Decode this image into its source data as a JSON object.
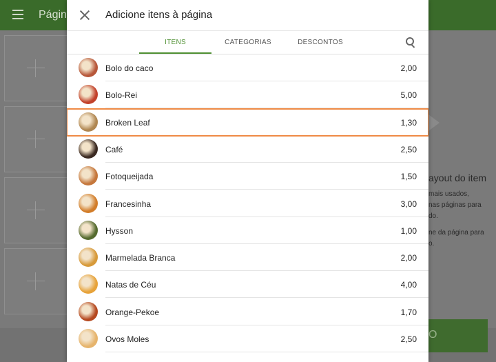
{
  "background": {
    "page_title": "Págin",
    "right_heading": "ayout do item",
    "right_lines": [
      "mais usados,",
      "nas páginas para",
      "do.",
      "ne da página para",
      "o."
    ],
    "green_button_label": "O"
  },
  "dialog": {
    "title": "Adicione itens à página",
    "tabs": [
      {
        "label": "ITENS",
        "active": true
      },
      {
        "label": "CATEGORIAS",
        "active": false
      },
      {
        "label": "DESCONTOS",
        "active": false
      }
    ],
    "items": [
      {
        "name": "Bolo do caco",
        "price": "2,00",
        "thumb_color": "#b7573a"
      },
      {
        "name": "Bolo-Rei",
        "price": "5,00",
        "thumb_color": "#c2412b"
      },
      {
        "name": "Broken Leaf",
        "price": "1,30",
        "thumb_color": "#b08752",
        "highlighted": true
      },
      {
        "name": "Café",
        "price": "2,50",
        "thumb_color": "#3b2a22"
      },
      {
        "name": "Fotoqueijada",
        "price": "1,50",
        "thumb_color": "#c5773c"
      },
      {
        "name": "Francesinha",
        "price": "3,00",
        "thumb_color": "#d27d2a"
      },
      {
        "name": "Hysson",
        "price": "1,00",
        "thumb_color": "#556b2f"
      },
      {
        "name": "Marmelada Branca",
        "price": "2,00",
        "thumb_color": "#d79a3a"
      },
      {
        "name": "Natas de Céu",
        "price": "4,00",
        "thumb_color": "#e7a33a"
      },
      {
        "name": "Orange-Pekoe",
        "price": "1,70",
        "thumb_color": "#b5481f"
      },
      {
        "name": "Ovos Moles",
        "price": "2,50",
        "thumb_color": "#e6b46c"
      }
    ]
  },
  "colors": {
    "accent": "#4e8f31",
    "highlight": "#ef8a45"
  }
}
